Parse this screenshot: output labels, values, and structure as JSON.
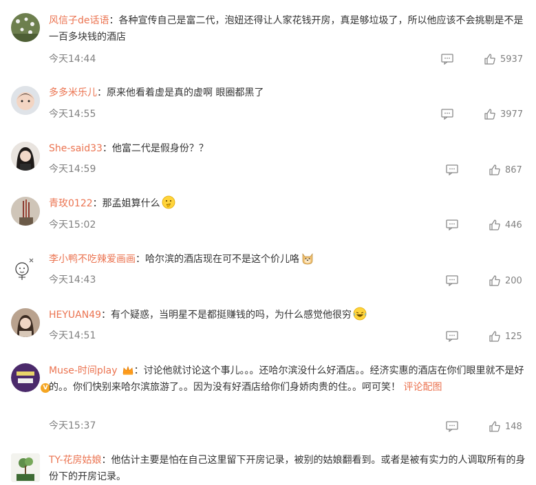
{
  "comments": [
    {
      "user": "风信子de话语",
      "sep": "：",
      "text": "各种宣传自己是富二代，泡妞还得让人家花钱开房，真是够垃圾了，所以他应该不会挑剔是不是一百多块钱的酒店",
      "time": "今天14:44",
      "likes": "5937"
    },
    {
      "user": "多多米乐儿",
      "sep": "：",
      "text": "原来他看着虚是真的虚啊 眼圈都黑了",
      "time": "今天14:55",
      "likes": "3977"
    },
    {
      "user": "She-said33",
      "sep": "：",
      "text": "他富二代是假身份？？",
      "time": "今天14:59",
      "likes": "867"
    },
    {
      "user": "青玫0122",
      "sep": "：",
      "text": "那孟姐算什么",
      "time": "今天15:02",
      "likes": "446"
    },
    {
      "user": "李小鸭不吃辣爱画画",
      "sep": "：",
      "text": "哈尔滨的酒店现在可不是这个价儿咯",
      "time": "今天14:43",
      "likes": "200"
    },
    {
      "user": "HEYUAN49",
      "sep": "：",
      "text": "有个疑惑，当明星不是都挺赚钱的吗，为什么感觉他很穷",
      "time": "今天14:51",
      "likes": "125"
    },
    {
      "user": "Muse-时间play",
      "sep": "：",
      "text": "讨论他就讨论这个事儿。。。还哈尔滨没什么好酒店。。经济实惠的酒店在你们眼里就不是好的。。你们快别来哈尔滨旅游了。。因为没有好酒店给你们身娇肉贵的住。。呵可笑！",
      "link": "评论配图",
      "time": "今天15:37",
      "likes": "148",
      "badge": "V"
    },
    {
      "user": "TY-花房姑娘",
      "sep": "：",
      "text": "他估计主要是怕在自己这里留下开房记录，被别的姑娘翻看到。或者是被有实力的人调取所有的身份下的开房记录。"
    }
  ]
}
